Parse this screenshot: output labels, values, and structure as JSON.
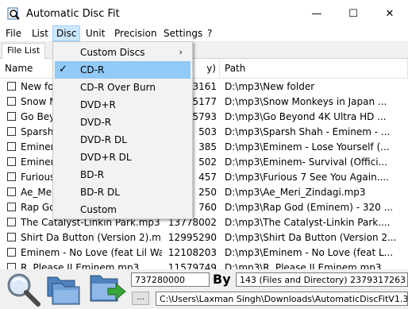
{
  "window": {
    "title": "Automatic Disc Fit",
    "minimize_glyph": "—",
    "maximize_glyph": "☐",
    "close_glyph": "✕"
  },
  "menubar": {
    "items": [
      "File",
      "List",
      "Disc",
      "Unit",
      "Precision",
      "Settings",
      "?"
    ],
    "active": "Disc"
  },
  "tabs": [
    "File List"
  ],
  "list": {
    "columns": [
      "Name",
      "y)",
      "Path"
    ],
    "rows": [
      {
        "name": "New fo",
        "size": "3161",
        "path": "D:\\mp3\\New folder"
      },
      {
        "name": "Snow M",
        "size": "5177",
        "path": "D:\\mp3\\Snow Monkeys in Japan ..."
      },
      {
        "name": "Go Beyo",
        "size": "5793",
        "path": "D:\\mp3\\Go Beyond  4K Ultra HD ..."
      },
      {
        "name": "Sparsh",
        "size": "503",
        "path": "D:\\mp3\\Sparsh Shah - Eminem - ..."
      },
      {
        "name": "Eminen",
        "size": "385",
        "path": "D:\\mp3\\Eminem - Lose Yourself (..."
      },
      {
        "name": "Eminen",
        "size": "502",
        "path": "D:\\mp3\\Eminem- Survival (Offici..."
      },
      {
        "name": "Furious",
        "size": "457",
        "path": "D:\\mp3\\Furious 7 See You Again...."
      },
      {
        "name": "Ae_Meri",
        "size": "250",
        "path": "D:\\mp3\\Ae_Meri_Zindagi.mp3"
      },
      {
        "name": "Rap Go",
        "size": "760",
        "path": "D:\\mp3\\Rap God (Eminem) - 320 ..."
      },
      {
        "name": "The Catalyst-Linkin Park.mp3",
        "size": "13778002",
        "path": "D:\\mp3\\The Catalyst-Linkin Park...."
      },
      {
        "name": "Shirt Da Button (Version 2).mp3",
        "size": "12995290",
        "path": "D:\\mp3\\Shirt Da Button (Version 2..."
      },
      {
        "name": "Eminem - No Love (feat Lil Wa...",
        "size": "12108203",
        "path": "D:\\mp3\\Eminem - No Love (feat L..."
      },
      {
        "name": "R. Please II Eminem mp3",
        "size": "11579749",
        "path": "D:\\mp3\\R. Please II Eminem.mp3"
      }
    ]
  },
  "disc_menu": {
    "items": [
      {
        "label": "Custom Discs",
        "submenu": true,
        "submenu_glyph": "›"
      },
      {
        "label": "CD-R",
        "checked": true,
        "check_glyph": "✓"
      },
      {
        "label": "CD-R Over Burn"
      },
      {
        "label": "DVD+R"
      },
      {
        "label": "DVD-R"
      },
      {
        "label": "DVD-R DL"
      },
      {
        "label": "DVD+R DL"
      },
      {
        "label": "BD-R"
      },
      {
        "label": "BD-R DL"
      },
      {
        "label": "Custom"
      }
    ]
  },
  "bottom": {
    "capacity_value": "737280000",
    "by_label": "By",
    "summary": "143 (Files and Directory) 2379317263 By (Mi",
    "small_button": "...",
    "output_path": "C:\\Users\\Laxman Singh\\Downloads\\AutomaticDiscFitV1.37(x64)"
  },
  "colors": {
    "menu_highlight": "#91c9f7",
    "active_menu_bg": "#cce8ff",
    "folder_blue": "#5b9bd5",
    "arrow_green": "#3aa53a"
  }
}
